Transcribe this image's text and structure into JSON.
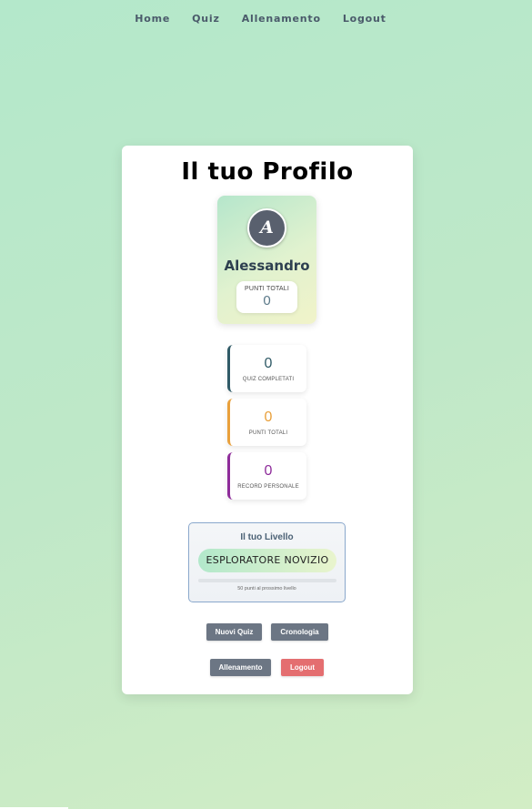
{
  "nav": {
    "items": [
      "Home",
      "Quiz",
      "Allenamento",
      "Logout"
    ]
  },
  "profile": {
    "title": "Il tuo Profilo",
    "avatar_initial": "A",
    "username": "Alessandro",
    "points_label": "PUNTI TOTALI",
    "points_value": "0"
  },
  "stats": [
    {
      "value": "0",
      "label": "QUIZ COMPLETATI",
      "color": "#2f5a66"
    },
    {
      "value": "0",
      "label": "PUNTI TOTALI",
      "color": "#e9a03b"
    },
    {
      "value": "0",
      "label": "RECORD PERSONALE",
      "color": "#8e2c9a"
    }
  ],
  "level": {
    "title": "Il tuo Livello",
    "name": "ESPLORATORE NOVIZIO",
    "progress_percent": 0,
    "note": "50 punti al prossimo livello"
  },
  "actions": {
    "new_quiz": "Nuovi Quiz",
    "history": "Cronologia",
    "training": "Allenamento",
    "logout": "Logout"
  }
}
